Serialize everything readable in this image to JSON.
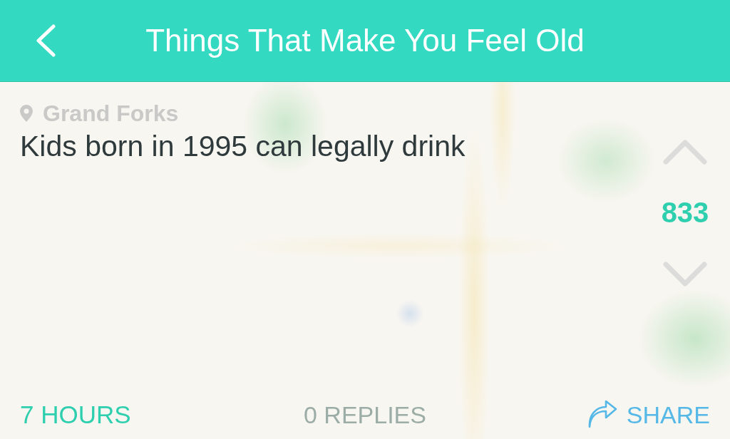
{
  "header": {
    "title": "Things That Make You Feel Old"
  },
  "post": {
    "location": "Grand Forks",
    "text": "Kids born in 1995 can legally drink",
    "score": "833"
  },
  "footer": {
    "time": "7 HOURS",
    "replies": "0 REPLIES",
    "share": "SHARE"
  }
}
